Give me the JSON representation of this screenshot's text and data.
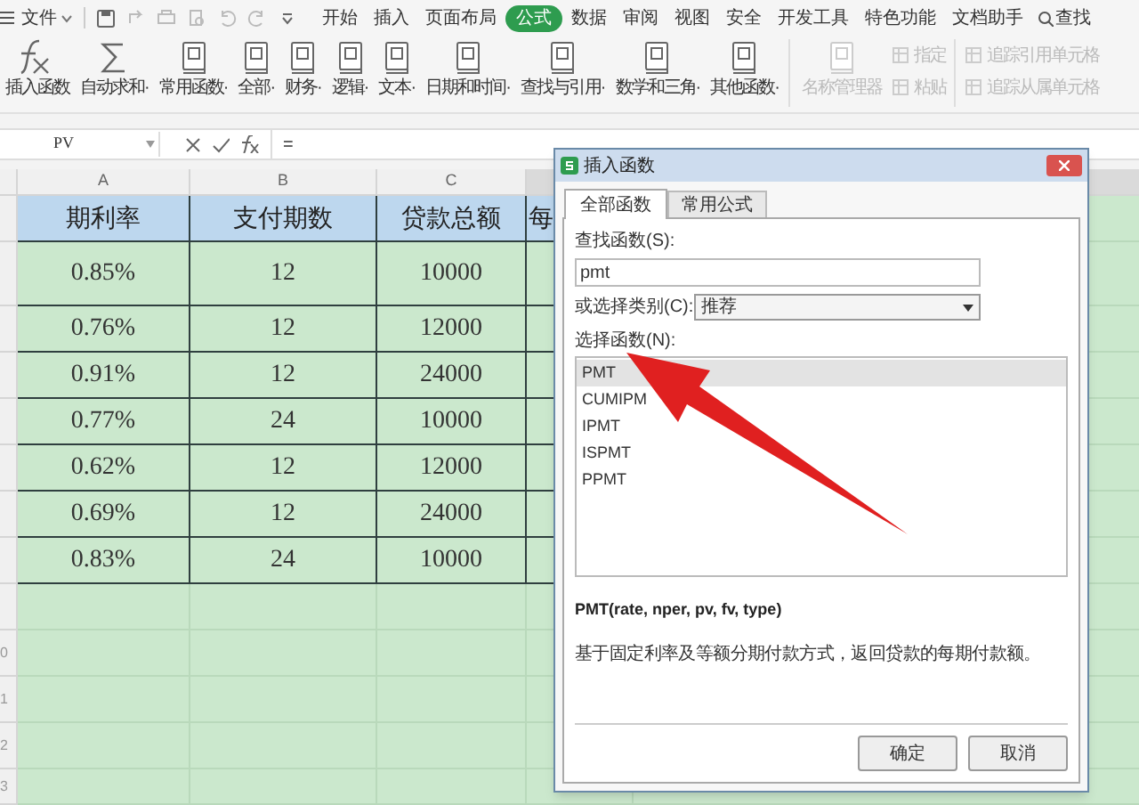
{
  "menu": {
    "file_label": "文件",
    "search_label": "查找"
  },
  "menu_tabs": [
    {
      "label": "开始",
      "selected": false
    },
    {
      "label": "插入",
      "selected": false
    },
    {
      "label": "页面布局",
      "selected": false
    },
    {
      "label": "公式",
      "selected": true
    },
    {
      "label": "数据",
      "selected": false
    },
    {
      "label": "审阅",
      "selected": false
    },
    {
      "label": "视图",
      "selected": false
    },
    {
      "label": "安全",
      "selected": false
    },
    {
      "label": "开发工具",
      "selected": false
    },
    {
      "label": "特色功能",
      "selected": false
    },
    {
      "label": "文档助手",
      "selected": false
    }
  ],
  "ribbon": {
    "large": [
      {
        "label": "插入函数",
        "disabled": false,
        "kind": "fx"
      },
      {
        "label": "自动求和·",
        "disabled": false,
        "kind": "sum"
      },
      {
        "label": "常用函数·",
        "disabled": false,
        "kind": "book"
      },
      {
        "label": "全部·",
        "disabled": false,
        "kind": "book"
      },
      {
        "label": "财务·",
        "disabled": false,
        "kind": "book"
      },
      {
        "label": "逻辑·",
        "disabled": false,
        "kind": "book"
      },
      {
        "label": "文本·",
        "disabled": false,
        "kind": "book"
      },
      {
        "label": "日期和时间·",
        "disabled": false,
        "kind": "book"
      },
      {
        "label": "查找与引用·",
        "disabled": false,
        "kind": "book"
      },
      {
        "label": "数学和三角·",
        "disabled": false,
        "kind": "book"
      },
      {
        "label": "其他函数·",
        "disabled": false,
        "kind": "book"
      },
      {
        "label": "名称管理器",
        "disabled": true,
        "kind": "book"
      }
    ],
    "small": [
      [
        {
          "label": "指定",
          "disabled": true
        },
        {
          "label": "粘贴",
          "disabled": true
        }
      ],
      [
        {
          "label": "追踪引用单元格",
          "disabled": true
        },
        {
          "label": "追踪从属单元格",
          "disabled": true
        }
      ]
    ]
  },
  "formula_bar": {
    "name_box": "PV",
    "formula": "="
  },
  "sheet": {
    "columns": [
      "A",
      "B",
      "C"
    ],
    "header": [
      "期利率",
      "支付期数",
      "贷款总额",
      "每"
    ],
    "rows": [
      [
        "0.85%",
        "12",
        "10000"
      ],
      [
        "0.76%",
        "12",
        "12000"
      ],
      [
        "0.91%",
        "12",
        "24000"
      ],
      [
        "0.77%",
        "24",
        "10000"
      ],
      [
        "0.62%",
        "12",
        "12000"
      ],
      [
        "0.69%",
        "12",
        "24000"
      ],
      [
        "0.83%",
        "24",
        "10000"
      ]
    ],
    "row_numbers": [
      "0",
      "1",
      "2",
      "3"
    ]
  },
  "dialog": {
    "title": "插入函数",
    "tabs": [
      {
        "label": "全部函数",
        "selected": true
      },
      {
        "label": "常用公式",
        "selected": false
      }
    ],
    "search_label": "查找函数(S):",
    "search_value": "pmt",
    "category_label": "或选择类别(C):",
    "category_value": "推荐",
    "list_label": "选择函数(N):",
    "functions": [
      {
        "name": "PMT",
        "selected": true
      },
      {
        "name": "CUMIPM",
        "selected": false
      },
      {
        "name": "IPMT",
        "selected": false
      },
      {
        "name": "ISPMT",
        "selected": false
      },
      {
        "name": "PPMT",
        "selected": false
      }
    ],
    "signature": "PMT(rate, nper, pv, fv, type)",
    "description": "基于固定利率及等额分期付款方式，返回贷款的每期付款额。",
    "buttons": [
      "确定",
      "取消"
    ]
  }
}
